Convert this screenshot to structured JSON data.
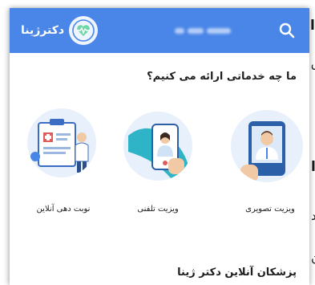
{
  "background": {
    "left_chars": [
      "ا",
      "ق",
      "ا",
      "ه",
      "د",
      "ن"
    ]
  },
  "header": {
    "logo_text": "دکترژینا",
    "search_icon": "search-icon",
    "logo_icon": "heart-pulse-icon",
    "bg_color": "#4a86e8"
  },
  "services_section": {
    "title": "ما چه خدماتی ارائه می کنیم؟",
    "items": [
      {
        "label": "ویزیت تصویری",
        "icon": "video-visit-illustration"
      },
      {
        "label": "ویزیت تلفنی",
        "icon": "phone-visit-illustration"
      },
      {
        "label": "نوبت دهی آنلاین",
        "icon": "online-appointment-illustration"
      }
    ]
  },
  "doctors_section": {
    "title": "پزشکان آنلاین دکتر ژینا"
  }
}
